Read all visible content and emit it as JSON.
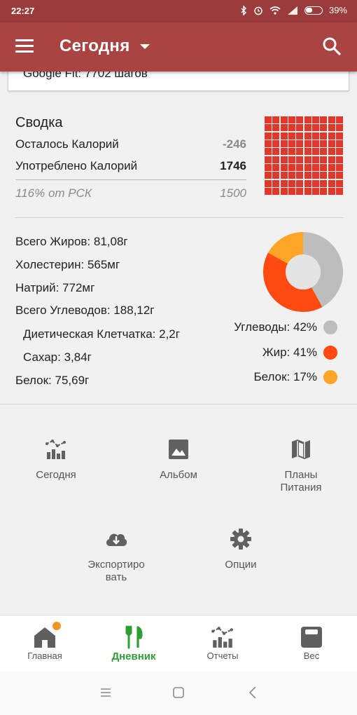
{
  "status_bar": {
    "time": "22:27",
    "battery": "39%"
  },
  "app_bar": {
    "title": "Сегодня"
  },
  "fit_card": {
    "text": "Google Fit: 7702 шагов"
  },
  "summary": {
    "title": "Сводка",
    "remaining_label": "Осталось Калорий",
    "remaining_value": "-246",
    "consumed_label": "Употреблено Калорий",
    "consumed_value": "1746",
    "percent_label": "116% от РСК",
    "rsk_value": "1500",
    "grid_fill_fraction": 1.0,
    "grid_color": "#e0392b"
  },
  "nutrients": {
    "fat": "Всего Жиров: 81,08г",
    "cholesterol": "Холестерин: 565мг",
    "sodium": "Натрий: 772мг",
    "carbs": "Всего Углеводов: 188,12г",
    "fiber": "Диетическая Клетчатка: 2,2г",
    "sugar": "Сахар: 3,84г",
    "protein": "Белок: 75,69г"
  },
  "macros": [
    {
      "label": "Углеводы: 42%",
      "percent": 42,
      "color": "#bdbdbd"
    },
    {
      "label": "Жир: 41%",
      "percent": 41,
      "color": "#ff4b12"
    },
    {
      "label": "Белок: 17%",
      "percent": 17,
      "color": "#ffa425"
    }
  ],
  "shortcuts": {
    "today": "Сегодня",
    "album": "Альбом",
    "plans_line1": "Планы",
    "plans_line2": "Питания",
    "export_line1": "Экспортиро",
    "export_line2": "вать",
    "options": "Опции"
  },
  "bottom_nav": {
    "home": "Главная",
    "diary": "Дневник",
    "reports": "Отчеты",
    "weight": "Вес",
    "active_color": "#2e9e33"
  }
}
